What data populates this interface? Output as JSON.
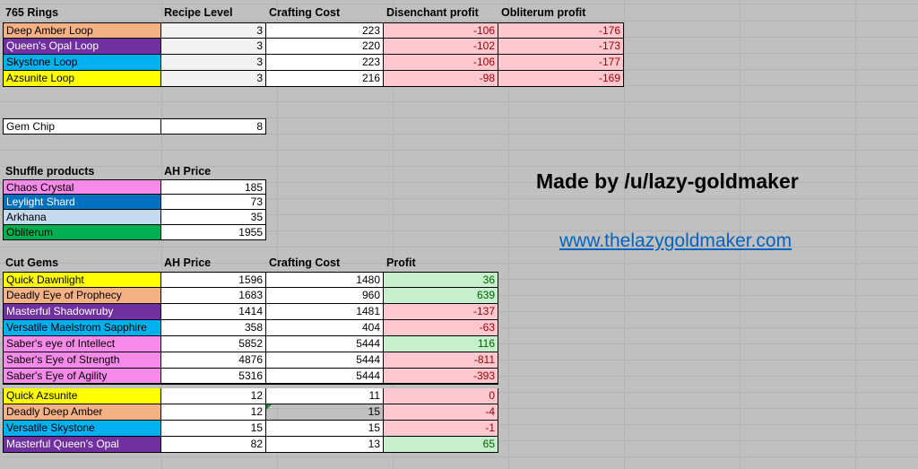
{
  "rings": {
    "headers": [
      "765 Rings",
      "Recipe Level",
      "Crafting Cost",
      "Disenchant profit",
      "Obliterum profit"
    ],
    "rows": [
      {
        "name": "Deep Amber Loop",
        "color": "#f4b183",
        "level": "3",
        "cost": "223",
        "de": "-106",
        "ob": "-176"
      },
      {
        "name": "Queen's Opal Loop",
        "color": "#7030a0",
        "level": "3",
        "cost": "220",
        "de": "-102",
        "ob": "-173"
      },
      {
        "name": "Skystone Loop",
        "color": "#00b0f0",
        "level": "3",
        "cost": "223",
        "de": "-106",
        "ob": "-177"
      },
      {
        "name": "Azsunite Loop",
        "color": "#ffff00",
        "level": "3",
        "cost": "216",
        "de": "-98",
        "ob": "-169"
      }
    ]
  },
  "gem_chip": {
    "name": "Gem Chip",
    "value": "8"
  },
  "shuffle": {
    "headers": [
      "Shuffle products",
      "AH Price"
    ],
    "rows": [
      {
        "name": "Chaos Crystal",
        "price": "185"
      },
      {
        "name": "Leylight Shard",
        "price": "73"
      },
      {
        "name": "Arkhana",
        "price": "35"
      },
      {
        "name": "Obliterum",
        "price": "1955"
      }
    ]
  },
  "cut_gems": {
    "headers": [
      "Cut Gems",
      "AH Price",
      "Crafting Cost",
      "Profit"
    ],
    "rows": [
      {
        "name": "Quick Dawnlight",
        "price": "1596",
        "cost": "1480",
        "profit": "36"
      },
      {
        "name": "Deadly Eye of Prophecy",
        "price": "1683",
        "cost": "960",
        "profit": "639"
      },
      {
        "name": "Masterful Shadowruby",
        "price": "1414",
        "cost": "1481",
        "profit": "-137"
      },
      {
        "name": "Versatile Maelstrom Sapphire",
        "price": "358",
        "cost": "404",
        "profit": "-63"
      },
      {
        "name": "Saber's eye of Intellect",
        "price": "5852",
        "cost": "5444",
        "profit": "116"
      },
      {
        "name": "Saber's Eye of Strength",
        "price": "4876",
        "cost": "5444",
        "profit": "-811"
      },
      {
        "name": "Saber's Eye of Agility",
        "price": "5316",
        "cost": "5444",
        "profit": "-393"
      },
      {
        "name": "Quick Azsunite",
        "price": "12",
        "cost": "11",
        "profit": "0"
      },
      {
        "name": "Deadly Deep Amber",
        "price": "12",
        "cost": "15",
        "profit": "-4"
      },
      {
        "name": "Versatile Skystone",
        "price": "15",
        "cost": "15",
        "profit": "-1"
      },
      {
        "name": "Masterful Queen's Opal",
        "price": "82",
        "cost": "13",
        "profit": "65"
      }
    ]
  },
  "credit": {
    "made_by": "Made by /u/lazy-goldmaker",
    "site": "www.thelazygoldmaker.com"
  },
  "colors": {
    "amber": "#f4b183",
    "purple": "#7030a0",
    "cyan": "#00b0f0",
    "yellow": "#ffff00",
    "pink": "#f58ae8",
    "blue": "#0070c0",
    "light_blue": "#c5d9f1",
    "green": "#00b050",
    "neg_fill": "#ffc7ce",
    "pos_fill": "#c6efce"
  }
}
